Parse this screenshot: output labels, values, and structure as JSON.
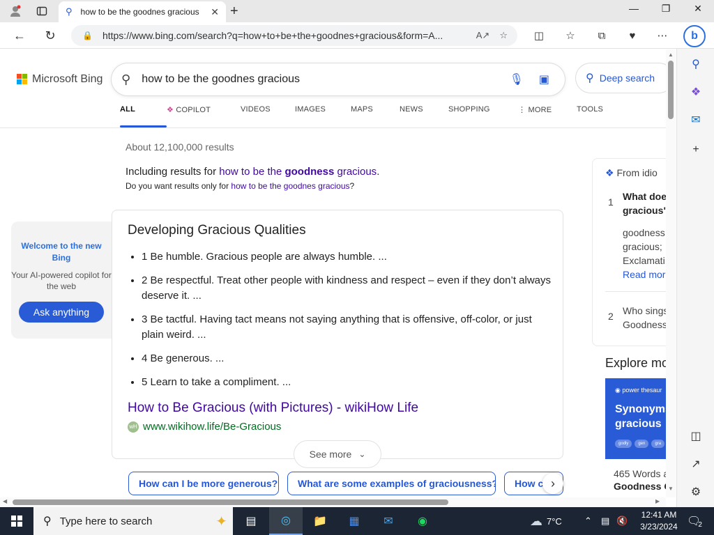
{
  "browser": {
    "tab_title": "how to be the goodnes gracious",
    "url": "https://www.bing.com/search?q=how+to+be+the+goodnes+gracious&form=A..."
  },
  "bing": {
    "logo_text": "Microsoft Bing",
    "query": "how to be the goodnes gracious",
    "deep_search": "Deep search",
    "scopes": [
      "ALL",
      "COPILOT",
      "VIDEOS",
      "IMAGES",
      "MAPS",
      "NEWS",
      "SHOPPING",
      "MORE",
      "TOOLS"
    ],
    "result_count": "About 12,100,000 results",
    "including_prefix": "Including results for ",
    "including_a": "how to be the ",
    "including_bold": "goodness",
    "including_b": " gracious",
    "including_dot": ".",
    "suggest_prefix": "Do you want results only for ",
    "suggest_link": "how to be the goodnes gracious",
    "suggest_suffix": "?"
  },
  "welcome": {
    "title": "Welcome to the new Bing",
    "subtitle": "Your AI-powered copilot for the web",
    "button": "Ask anything"
  },
  "answer": {
    "title": "Developing Gracious Qualities",
    "items": [
      "1 Be humble. Gracious people are always humble. ...",
      "2 Be respectful. Treat other people with kindness and respect – even if they don’t always deserve it. ...",
      "3 Be tactful. Having tact means not saying anything that is offensive, off-color, or just plain weird. ...",
      "4 Be generous. ...",
      "5 Learn to take a compliment. ..."
    ],
    "link": "How to Be Gracious (with Pictures) - wikiHow Life",
    "cite": "www.wikihow.life/Be-Gracious",
    "see_more": "See more"
  },
  "related_pills": [
    "How can I be more generous?",
    "What are some examples of graciousness?",
    "How can I be..."
  ],
  "right_panel": {
    "source": "From idio",
    "q1_num": "1",
    "q1": "What does",
    "q1b": "gracious\"",
    "a1": "goodness",
    "a1b": "gracious;",
    "a1c": "Exclamati",
    "read_more": "Read mor",
    "q2_num": "2",
    "q2": "Who sings",
    "q2b": "Goodness",
    "explore": "Explore mo",
    "tile_brand": "power thesaur",
    "tile_title": "Synonyms",
    "tile_title2": "gracious",
    "tile_chips": [
      "godly",
      "gen",
      "gra"
    ],
    "caption1": "465 Words a",
    "caption2": "Goodness G"
  },
  "taskbar": {
    "search_placeholder": "Type here to search",
    "weather": "7°C",
    "time": "12:41 AM",
    "date": "3/23/2024",
    "notif_count": "2"
  },
  "colors": {
    "bing_blue": "#2557d6",
    "visited_link": "#4007a2",
    "cite_green": "#006d21",
    "taskbar": "#1c2533"
  }
}
